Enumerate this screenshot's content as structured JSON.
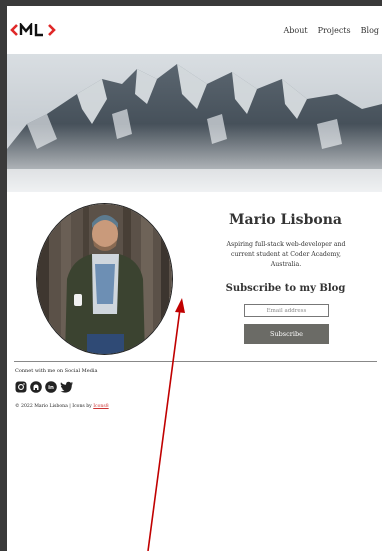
{
  "nav": {
    "about": "About",
    "projects": "Projects",
    "blog": "Blog"
  },
  "profile": {
    "name": "Mario Lisbona",
    "bio": "Aspiring full-stack web-developer and current student at Coder Academy, Australia."
  },
  "subscribe": {
    "heading": "Subscribe to my Blog",
    "email_placeholder": "Email address",
    "button_label": "Subscribe"
  },
  "footer": {
    "social_title": "Connet with me on Social Media",
    "copyright_text": "© 2022 Mario Lisbona | Icons by",
    "icons_link": "Icons8",
    "social_icons": [
      "instagram-icon",
      "github-icon",
      "linkedin-icon",
      "twitter-icon"
    ]
  },
  "colors": {
    "accent": "#e02828",
    "button": "#6b6b66",
    "annotation_arrow": "#c00000"
  }
}
